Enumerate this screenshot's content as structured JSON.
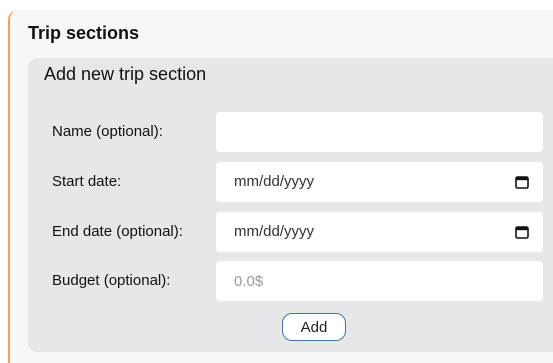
{
  "section": {
    "title": "Trip sections"
  },
  "form": {
    "title": "Add new trip section",
    "name_label": "Name (optional):",
    "name_value": "",
    "start_label": "Start date:",
    "start_value": "mm/dd/yyyy",
    "end_label": "End date (optional):",
    "end_value": "mm/dd/yyyy",
    "budget_label": "Budget (optional):",
    "budget_placeholder": "0.0$",
    "add_label": "Add"
  },
  "colors": {
    "accent": "#f0a55a",
    "button_border": "#4a6fa5",
    "panel_bg": "#e7e7ea"
  },
  "icons": {
    "date_picker": "calendar-icon"
  }
}
